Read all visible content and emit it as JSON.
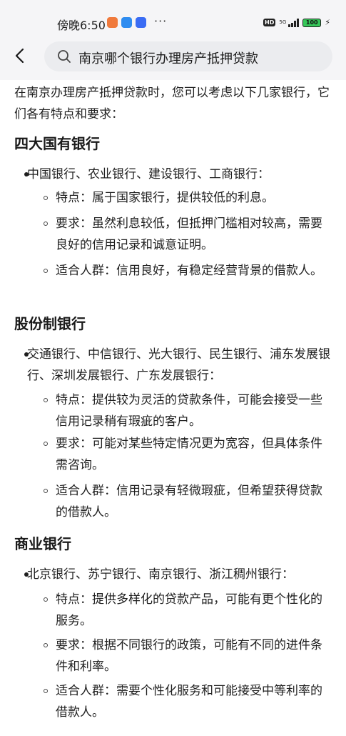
{
  "status": {
    "time": "傍晚6:50",
    "dots": "···",
    "network": "5G",
    "hd": "HD",
    "battery": "100",
    "app_icons": [
      "orange-app-icon",
      "blue-chat-icon",
      "blue-app-icon"
    ],
    "colors": {
      "orange": "#f07a3c",
      "blue": "#2e8cf0",
      "blue2": "#3a6cf4",
      "battery": "#35c759"
    }
  },
  "header": {
    "back_icon": "back-arrow-icon",
    "search_icon": "search-icon",
    "search_query": "南京哪个银行办理房产抵押贷款"
  },
  "article": {
    "intro": "在南京办理房产抵押贷款时，您可以考虑以下几家银行，它们各有特点和要求：",
    "sections": [
      {
        "heading": "四大国有银行",
        "bullet": "中国银行、农业银行、建设银行、工商银行：",
        "items": [
          "特点：属于国家银行，提供较低的利息。",
          "要求：虽然利息较低，但抵押门槛相对较高，需要良好的信用记录和诚意证明。",
          "适合人群：信用良好，有稳定经营背景的借款人。"
        ]
      },
      {
        "heading": "股份制银行",
        "bullet": "交通银行、中信银行、光大银行、民生银行、浦东发展银行、深圳发展银行、广东发展银行：",
        "items": [
          "特点：提供较为灵活的贷款条件，可能会接受一些信用记录稍有瑕疵的客户。",
          "要求：可能对某些特定情况更为宽容，但具体条件需咨询。",
          "适合人群：信用记录有轻微瑕疵，但希望获得贷款的借款人。"
        ]
      },
      {
        "heading": "商业银行",
        "bullet": "北京银行、苏宁银行、南京银行、浙江稠州银行：",
        "items": [
          "特点：提供多样化的贷款产品，可能有更个性化的服务。",
          "要求：根据不同银行的政策，可能有不同的进件条件和利率。",
          "适合人群：需要个性化服务和可能接受中等利率的借款人。"
        ]
      }
    ]
  }
}
